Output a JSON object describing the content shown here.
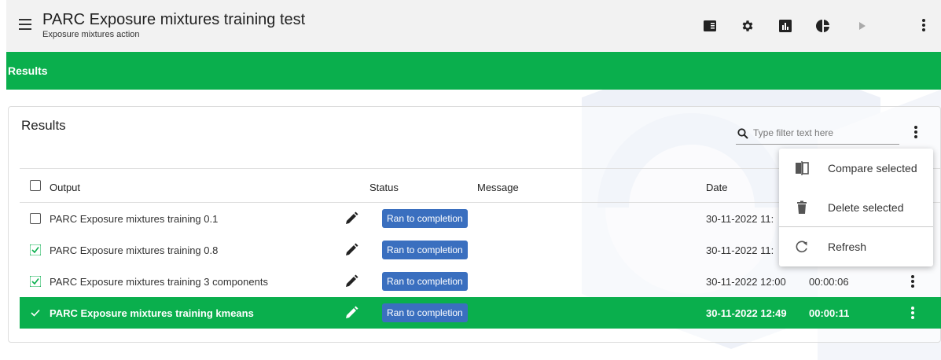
{
  "app": {
    "title": "PARC Exposure mixtures training test",
    "subtitle": "Exposure mixtures action"
  },
  "toolbar": {
    "icons": [
      "panel-icon",
      "gear-icon",
      "bar-chart-icon",
      "pie-chart-icon",
      "play-icon",
      "more-vert-icon"
    ]
  },
  "banner": {
    "label": "Results"
  },
  "card": {
    "title": "Results",
    "filter_placeholder": "Type filter text here"
  },
  "table": {
    "headers": {
      "output": "Output",
      "status": "Status",
      "message": "Message",
      "date": "Date"
    },
    "rows": [
      {
        "output": "PARC Exposure mixtures training 0.1",
        "status": "Ran to completion",
        "message": "",
        "date": "30-11-2022 11:",
        "duration": "",
        "checked": false,
        "selected": false
      },
      {
        "output": "PARC Exposure mixtures training 0.8",
        "status": "Ran to completion",
        "message": "",
        "date": "30-11-2022 11:",
        "duration": "",
        "checked": true,
        "selected": false
      },
      {
        "output": "PARC Exposure mixtures training 3 components",
        "status": "Ran to completion",
        "message": "",
        "date": "30-11-2022 12:00",
        "duration": "00:00:06",
        "checked": true,
        "selected": false
      },
      {
        "output": "PARC Exposure mixtures training kmeans",
        "status": "Ran to completion",
        "message": "",
        "date": "30-11-2022 12:49",
        "duration": "00:00:11",
        "checked": true,
        "selected": true
      }
    ]
  },
  "context_menu": {
    "items": [
      {
        "label": "Compare selected",
        "icon": "compare-icon"
      },
      {
        "label": "Delete selected",
        "icon": "trash-icon"
      },
      {
        "label": "Refresh",
        "icon": "refresh-icon"
      }
    ]
  },
  "colors": {
    "accent_green": "#0aaf4d",
    "badge_blue": "#3a6fbf",
    "topbar_bg": "#f2f2f2"
  }
}
